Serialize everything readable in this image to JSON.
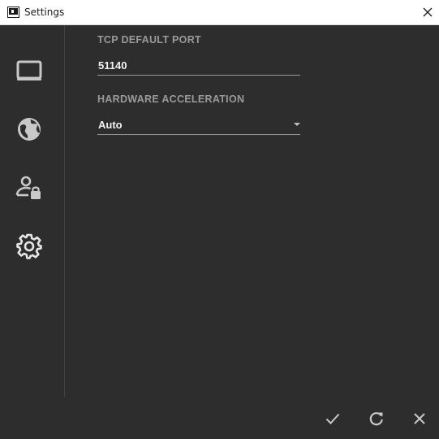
{
  "window": {
    "title": "Settings"
  },
  "sidebar": {
    "items": [
      {
        "name": "display",
        "icon": "monitor-icon"
      },
      {
        "name": "network",
        "icon": "globe-icon"
      },
      {
        "name": "security",
        "icon": "user-lock-icon"
      },
      {
        "name": "general",
        "icon": "gear-icon",
        "active": true
      }
    ]
  },
  "settings": {
    "tcp_port": {
      "label": "TCP DEFAULT PORT",
      "value": "51140"
    },
    "hardware_acceleration": {
      "label": "HARDWARE ACCELERATION",
      "value": "Auto"
    }
  },
  "actions": {
    "confirm_icon": "check-icon",
    "reset_icon": "refresh-icon",
    "cancel_icon": "close-icon"
  },
  "colors": {
    "background": "#2d2d2d",
    "icon": "#c8c8c8",
    "label": "#9a9a9a",
    "text": "#f2f2f2"
  }
}
